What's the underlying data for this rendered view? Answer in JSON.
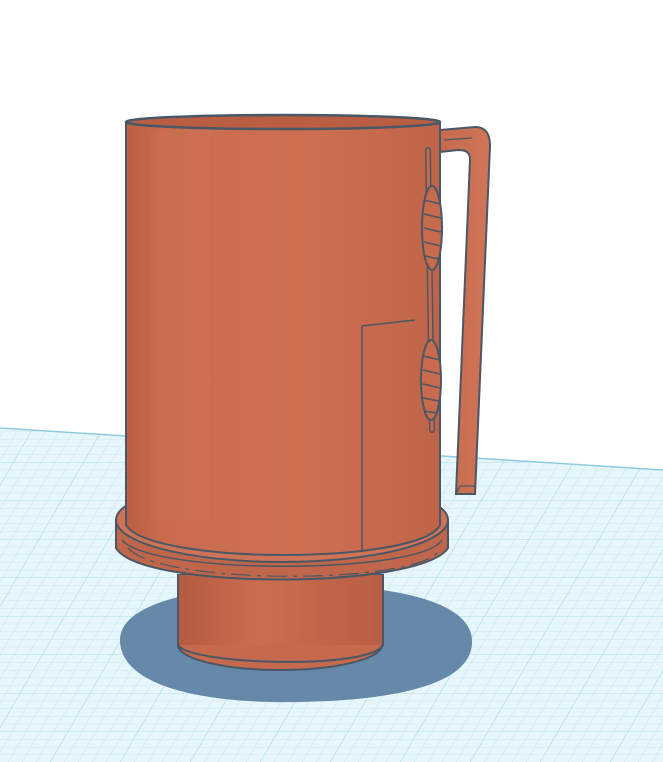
{
  "scene": {
    "model": "cylindrical-cup-with-handle",
    "colors": {
      "model": "#c86a4d",
      "model_shade": "#b95e43",
      "model_dark": "#9f4d35",
      "model_light": "#d27a5c",
      "outline": "#4a5766",
      "workplane": "#e7f6fb",
      "grid_line": "#c2e3ee",
      "grid_major": "#9fd2e3",
      "shadow": "#5f82a4",
      "background": "#ffffff"
    },
    "icons": {
      "workplane": "grid-icon",
      "shadow": "shadow-icon"
    }
  }
}
